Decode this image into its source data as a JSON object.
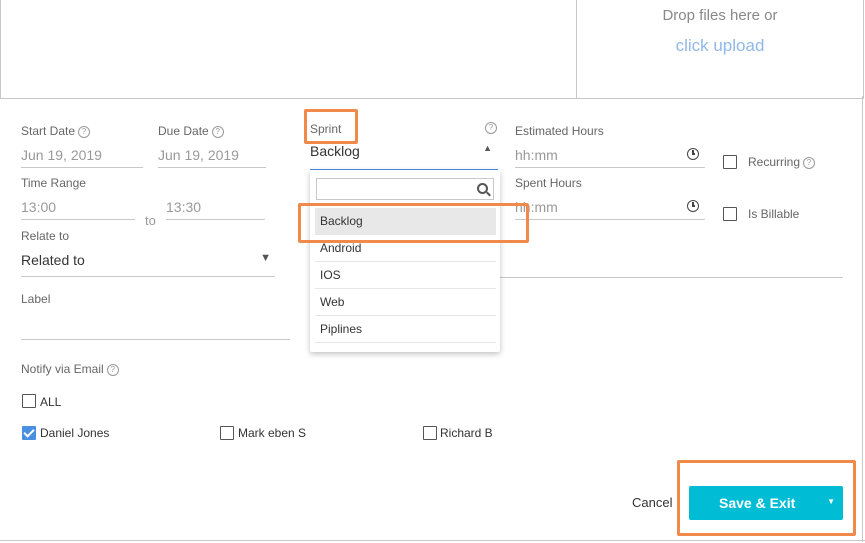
{
  "upload": {
    "drop_text": "Drop files here or",
    "link_text": "click upload"
  },
  "form": {
    "start_date": {
      "label": "Start Date",
      "value": "Jun 19, 2019"
    },
    "due_date": {
      "label": "Due Date",
      "value": "Jun 19, 2019"
    },
    "sprint": {
      "label": "Sprint",
      "value": "Backlog"
    },
    "estimated_hours": {
      "label": "Estimated Hours",
      "placeholder": "hh:mm"
    },
    "spent_hours": {
      "label": "Spent Hours",
      "placeholder": "hh:mm"
    },
    "recurring": {
      "label": "Recurring"
    },
    "billable": {
      "label": "Is Billable"
    },
    "time_range": {
      "label": "Time Range",
      "from": "13:00",
      "sep": "to",
      "to": "13:30"
    },
    "relate_to": {
      "label": "Relate to",
      "value": "Related to"
    },
    "label_field": {
      "label": "Label"
    },
    "notify": {
      "label": "Notify via Email",
      "all": "ALL",
      "users": [
        {
          "name": "Daniel Jones",
          "checked": true
        },
        {
          "name": "Mark eben S",
          "checked": false
        },
        {
          "name": "Richard B",
          "checked": false
        }
      ]
    }
  },
  "sprint_dropdown": {
    "search_placeholder": "",
    "options": [
      "Backlog",
      "Android",
      "IOS",
      "Web",
      "Piplines"
    ]
  },
  "footer": {
    "cancel": "Cancel",
    "save": "Save & Exit"
  },
  "colors": {
    "accent": "#00bcd4",
    "highlight": "#f08a4b",
    "link": "#90b8e8"
  }
}
